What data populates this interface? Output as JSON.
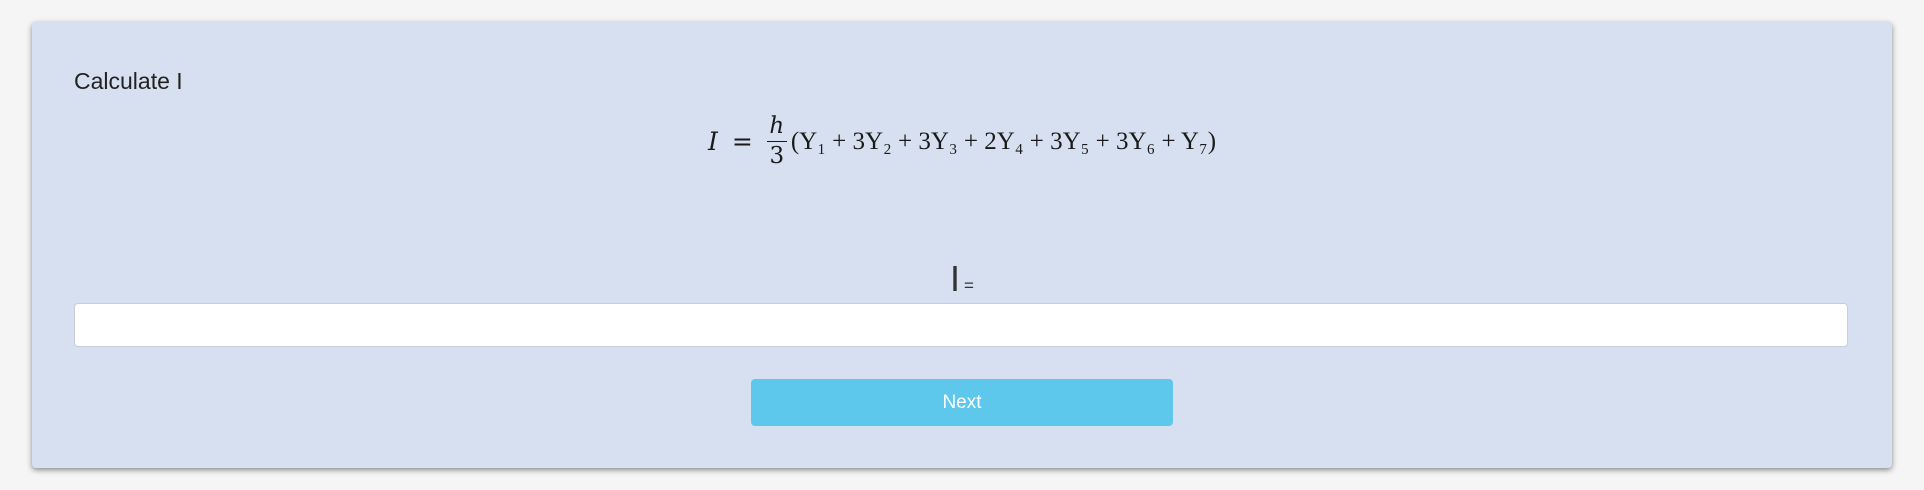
{
  "card": {
    "title": "Calculate I"
  },
  "formula": {
    "lhs": "I",
    "equals": "=",
    "frac_numerator": "h",
    "frac_denominator": "3",
    "rhs": "(Y₁ + 3Y₂ + 3Y₃ + 2Y₄ + 3Y₅ + 3Y₆ + Y₇)"
  },
  "answer": {
    "label_var": "I",
    "label_eq": "=",
    "value": "",
    "placeholder": ""
  },
  "actions": {
    "next_label": "Next"
  },
  "colors": {
    "card_bg": "#d6e0f0",
    "button_bg": "#5ec8ec"
  }
}
